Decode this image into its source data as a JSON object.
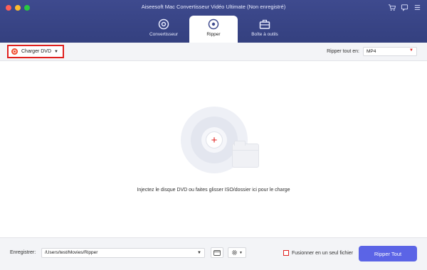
{
  "window": {
    "title": "Aiseesoft Mac Convertisseur Vidéo Ultimate (Non enregistré)"
  },
  "top_icons": [
    "cart-icon",
    "feedback-icon",
    "menu-icon"
  ],
  "tabs": [
    {
      "label": "Convertisseur",
      "icon": "convert-icon",
      "active": false
    },
    {
      "label": "Ripper",
      "icon": "ripper-icon",
      "active": true
    },
    {
      "label": "Boîte à outils",
      "icon": "toolbox-icon",
      "active": false
    }
  ],
  "toolbar": {
    "load_dvd_label": "Charger DVD",
    "rip_all_label": "Ripper tout en:",
    "format_value": "MP4"
  },
  "main": {
    "drop_hint": "Injectez le disque DVD ou faites glisser ISO/dossier ici pour le charge"
  },
  "bottom": {
    "save_label": "Enregistrer:",
    "save_path": "/Users/test/Movies/Ripper",
    "merge_label": "Fusionner en un seul fichier",
    "merge_checked": false,
    "rip_button_label": "Ripper Tout"
  },
  "colors": {
    "header": "#3e4a8e",
    "accent_red": "#e0201e",
    "primary_button": "#5b64e6"
  }
}
